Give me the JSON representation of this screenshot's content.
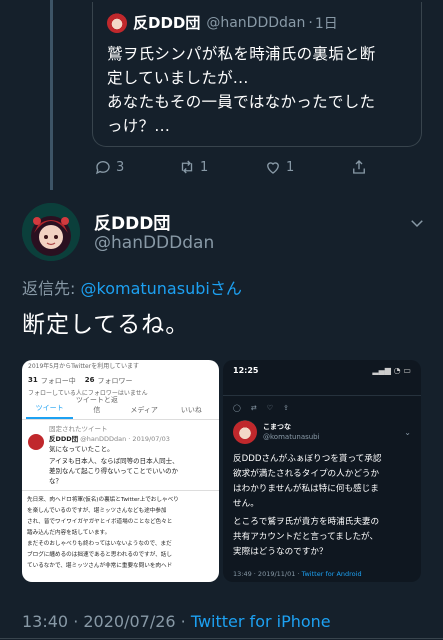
{
  "quoted_tweet": {
    "name": "反DDD団",
    "handle": "@hanDDDdan",
    "separator": "·",
    "age": "1日",
    "text_lines": [
      "鷲ヲ氏シンパが私を時浦氏の裏垢と断",
      "定していましたが...",
      "あなたもその一員ではなかったでした",
      "っけ？..."
    ],
    "actions": {
      "replies": "3",
      "retweets": "1",
      "likes": "1"
    }
  },
  "main_tweet": {
    "name": "反DDD団",
    "handle": "@hanDDDdan",
    "reply_to_prefix": "返信先:",
    "reply_to_mention": "@komatunasubiさん",
    "text": "断定してるね。",
    "timestamp": "13:40 · 2020/07/26 · ",
    "source": "Twitter for iPhone"
  },
  "media_left": {
    "top_notice": "2019年5月からTwitterを利用しています",
    "following": "31",
    "following_label": "フォロー中",
    "followers": "26",
    "followers_label": "フォロワー",
    "mutual_note": "フォローしている人にフォロワーはいません",
    "tabs": [
      "ツイート",
      "ツイートと返信",
      "メディア",
      "いいね"
    ],
    "pinned": "固定されたツイート",
    "pinned_name": "反DDD団",
    "pinned_handle": "@hanDDDdan · 2019/07/03",
    "pinned_text": [
      "気になっていたこと。",
      "アイヌも日本人、ならば同等の日本人同士、",
      "差別なんて起こり得ないってことでいいのか",
      "な？"
    ],
    "body_lines": [
      "先日来、肉ヘドロ将軍(仮名)の裏垢とTwitter上でおしゃべり",
      "を楽しんでいるのですが、堪ミッツさんなども途中参加",
      "され、皆でワイワイガヤガヤとイボ道場のことなど色々と",
      "踏み込んだ内容を話しています。",
      "まだそのおしゃべりも終わってはいないようなので、まだ",
      "ブログに纏めるのは拙速であると思われるのですが、話し",
      "ているなかで、堪ミッツさんが非常に重要な問いを肉ヘド"
    ]
  },
  "media_right": {
    "status_time": "12:25",
    "name": "こまつな",
    "handle": "@komatunasubi",
    "text_lines": [
      "反DDDさんがふぁぼりつを貰って承認",
      "欲求が満たされるタイプの人かどうか",
      "はわかりませんが私は特に何も感じま",
      "せん。",
      "ところで鷲ヲ氏が貴方を時浦氏夫妻の",
      "共有アカウントだと言ってましたが、",
      "実際はどうなのですか？"
    ],
    "timestamp": "13:49 · 2019/11/01 · ",
    "source": "Twitter for Android"
  },
  "colors": {
    "background": "#15202b",
    "text": "#ffffff",
    "muted": "#8899a6",
    "accent": "#1da1f2",
    "border": "#38444d"
  },
  "icons": [
    "reply-icon",
    "retweet-icon",
    "like-icon",
    "share-icon",
    "chevron-down-icon"
  ]
}
